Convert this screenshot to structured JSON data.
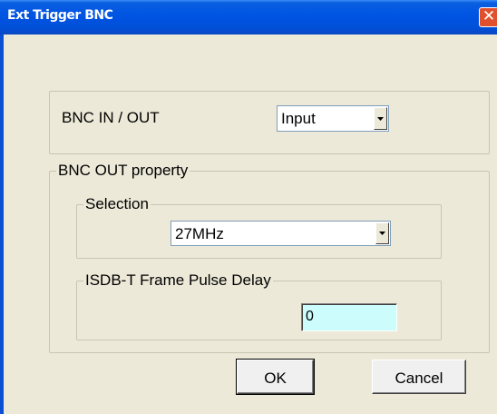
{
  "window": {
    "title": "Ext Trigger BNC",
    "close_glyph": "✕"
  },
  "bnc_io": {
    "label": "BNC IN / OUT",
    "selected": "Input"
  },
  "bnc_out": {
    "legend": "BNC OUT property",
    "selection": {
      "legend": "Selection",
      "selected": "27MHz"
    },
    "isdb": {
      "legend": "ISDB-T Frame Pulse Delay",
      "value": "0"
    }
  },
  "buttons": {
    "ok": "OK",
    "cancel": "Cancel"
  },
  "colors": {
    "titlebar": "#0054e3",
    "dialog_bg": "#ece9d8",
    "close_button": "#e0502c",
    "text_field_bg": "#ccfcfc"
  }
}
